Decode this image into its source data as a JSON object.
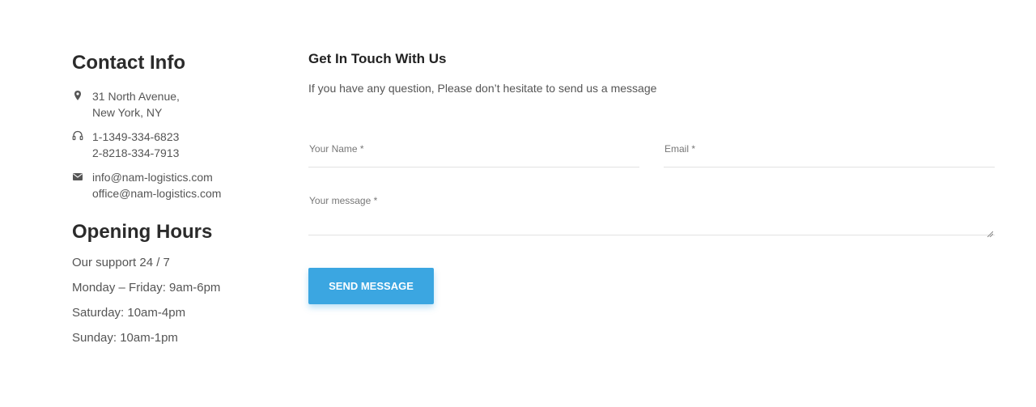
{
  "contact": {
    "title": "Contact Info",
    "items": [
      {
        "icon": "map-marker-icon",
        "lines": [
          "31 North Avenue,",
          "New York, NY"
        ]
      },
      {
        "icon": "headset-icon",
        "lines": [
          "1-1349-334-6823",
          "2-8218-334-7913"
        ]
      },
      {
        "icon": "envelope-icon",
        "lines": [
          "info@nam-logistics.com",
          "office@nam-logistics.com"
        ]
      }
    ]
  },
  "hours": {
    "title": "Opening Hours",
    "items": [
      "Our support 24 / 7",
      "Monday – Friday: 9am-6pm",
      "Saturday: 10am-4pm",
      "Sunday: 10am-1pm"
    ]
  },
  "form": {
    "title": "Get In Touch With Us",
    "subtitle": "If you have any question, Please don’t hesitate to send us a message",
    "name_placeholder": "Your Name *",
    "email_placeholder": "Email *",
    "message_placeholder": "Your message *",
    "submit_label": "SEND MESSAGE"
  },
  "colors": {
    "accent": "#3ba6e1",
    "heading": "#2b2b2b",
    "text": "#555555",
    "divider": "#e2e2e2"
  }
}
